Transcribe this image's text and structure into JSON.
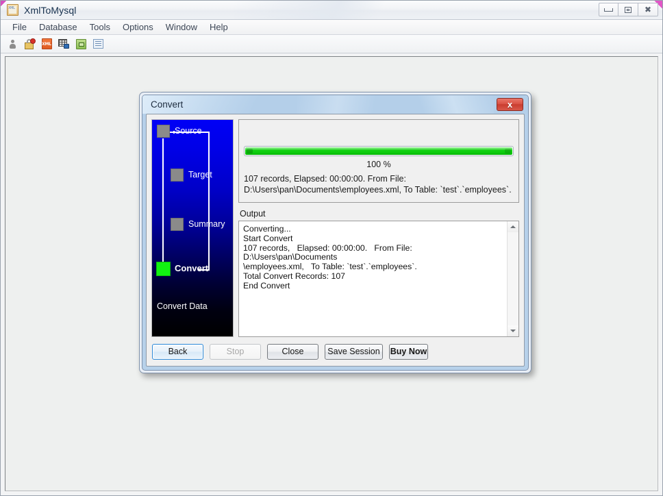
{
  "app": {
    "title": "XmlToMysql",
    "icon": "xml-app-icon",
    "window_controls": [
      {
        "name": "minimize-button",
        "glyph": "minimize-icon"
      },
      {
        "name": "restore-button",
        "glyph": "restore-icon"
      },
      {
        "name": "close-button",
        "glyph": "✕"
      }
    ]
  },
  "menu": {
    "items": [
      {
        "label": "File"
      },
      {
        "label": "Database"
      },
      {
        "label": "Tools"
      },
      {
        "label": "Options"
      },
      {
        "label": "Window"
      },
      {
        "label": "Help"
      }
    ]
  },
  "toolbar": {
    "buttons": [
      {
        "name": "user-icon",
        "tip": "User"
      },
      {
        "name": "lock-error-icon",
        "tip": "Connection"
      },
      {
        "name": "xml-file-icon",
        "tip": "XML",
        "text": "XML"
      },
      {
        "name": "table-convert-icon",
        "tip": "Convert"
      },
      {
        "name": "window-green-icon",
        "tip": "Session"
      },
      {
        "name": "list-blue-icon",
        "tip": "List"
      }
    ]
  },
  "dialog": {
    "title": "Convert",
    "close_label": "x",
    "wizard": {
      "steps": [
        {
          "label": "Source",
          "state": "done"
        },
        {
          "label": "Target",
          "state": "done"
        },
        {
          "label": "Summary",
          "state": "done"
        },
        {
          "label": "Convert",
          "state": "active"
        }
      ],
      "footer": "Convert Data",
      "active_color": "#12f312",
      "node_color": "#8a8a8a"
    },
    "progress": {
      "percent_label": "100 %",
      "percent_value": 100,
      "fill_color": "#0bc90b",
      "status_line1": "107 records,   Elapsed: 00:00:00.   From File:",
      "status_line2": "D:\\Users\\pan\\Documents\\employees.xml,   To Table: `test`.`employees`."
    },
    "output": {
      "label": "Output",
      "text": "Converting...\nStart Convert\n107 records,   Elapsed: 00:00:00.   From File: D:\\Users\\pan\\Documents\n\\employees.xml,   To Table: `test`.`employees`.\nTotal Convert Records: 107\nEnd Convert",
      "scrollbar": {
        "up": "scroll-up-arrow",
        "down": "scroll-down-arrow"
      }
    },
    "buttons": [
      {
        "id": "back",
        "label": "Back",
        "state": "focused"
      },
      {
        "id": "stop",
        "label": "Stop",
        "state": "disabled"
      },
      {
        "id": "close",
        "label": "Close",
        "state": "normal"
      },
      {
        "id": "save",
        "label": "Save Session",
        "state": "normal"
      },
      {
        "id": "buy",
        "label": "Buy Now",
        "state": "bold"
      }
    ]
  }
}
